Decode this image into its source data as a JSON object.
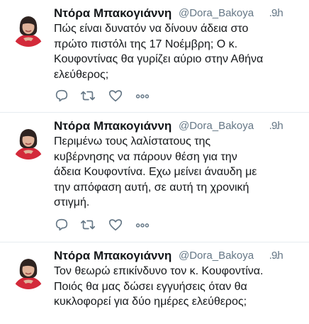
{
  "colors": {
    "text": "#14171a",
    "secondary": "#657786",
    "icon": "#657786",
    "divider": "#e6ecf0"
  },
  "tweets": [
    {
      "name": "Ντόρα Μπακογιάννη",
      "handle": "@Dora_Bakoya",
      "time": "9h",
      "lines": [
        "Πώς είναι δυνατόν να δίνουν άδεια στο",
        "πρώτο πιστόλι της 17 Νοέμβρη; Ο κ.",
        "Κουφοντίνας θα γυρίζει αύριο στην Αθήνα",
        "ελεύθερος;"
      ],
      "icons": [
        "reply-icon",
        "retweet-icon",
        "like-icon",
        "more-icon"
      ]
    },
    {
      "name": "Ντόρα Μπακογιάννη",
      "handle": "@Dora_Bakoya",
      "time": "9h",
      "lines": [
        "Περιμένω τους λαλίστατους της",
        "κυβέρνησης να πάρουν θέση για την",
        "άδεια Κουφοντίνα. Εχω μείνει άναυδη με",
        "την απόφαση αυτή, σε αυτή τη χρονική",
        "στιγμή."
      ],
      "icons": [
        "reply-icon",
        "retweet-icon",
        "like-icon",
        "more-icon"
      ]
    },
    {
      "name": "Ντόρα Μπακογιάννη",
      "handle": "@Dora_Bakoya",
      "time": "9h",
      "lines": [
        "Τον θεωρώ επικίνδυνο τον κ. Κουφοντίνα.",
        "Ποιός θα μας δώσει εγγυήσεις όταν θα",
        "κυκλοφορεί για δύο ημέρες ελεύθερος;"
      ],
      "icons": []
    }
  ]
}
